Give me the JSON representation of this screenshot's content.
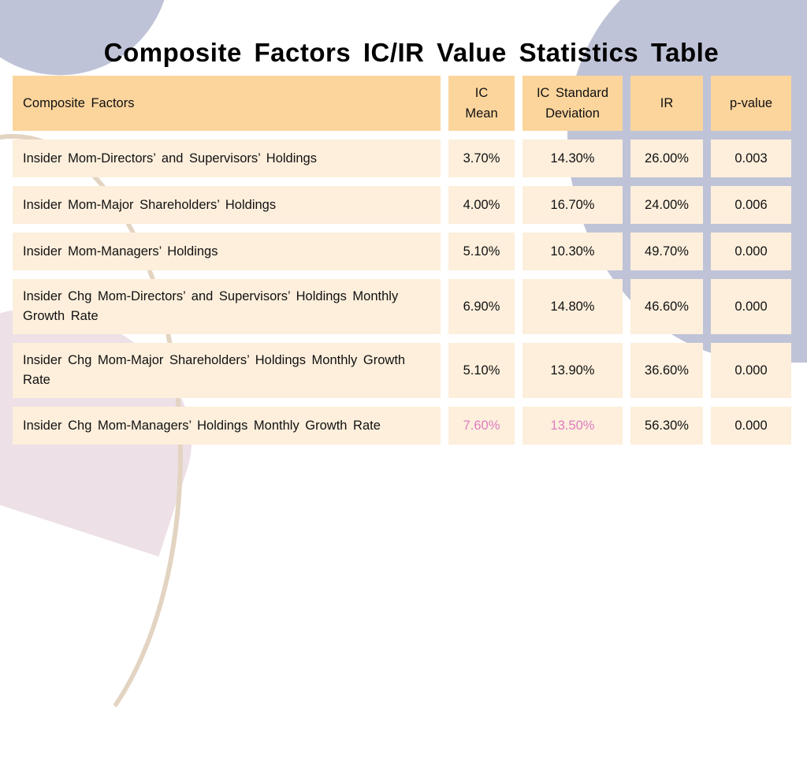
{
  "title": "Composite Factors IC/IR Value Statistics Table",
  "colors": {
    "header_bg": "#fcd59d",
    "cell_bg": "#fdefdc",
    "highlight_text": "#e07cc0",
    "accent_shape": "#bfc3d7"
  },
  "table": {
    "headers": [
      "Composite Factors",
      "IC\nMean",
      "IC Standard\nDeviation",
      "IR",
      "p-value"
    ],
    "rows": [
      {
        "factor": "Insider Mom-Directors’ and Supervisors’ Holdings",
        "ic_mean": "3.70%",
        "ic_std": "14.30%",
        "ir": "26.00%",
        "p_value": "0.003"
      },
      {
        "factor": "Insider Mom-Major Shareholders’ Holdings",
        "ic_mean": "4.00%",
        "ic_std": "16.70%",
        "ir": "24.00%",
        "p_value": "0.006"
      },
      {
        "factor": "Insider Mom-Managers’ Holdings",
        "ic_mean": "5.10%",
        "ic_std": "10.30%",
        "ir": "49.70%",
        "p_value": "0.000"
      },
      {
        "factor": "Insider Chg Mom-Directors’ and Supervisors’ Holdings Monthly Growth Rate",
        "ic_mean": "6.90%",
        "ic_std": "14.80%",
        "ir": "46.60%",
        "p_value": "0.000"
      },
      {
        "factor": "Insider Chg Mom-Major Shareholders’ Holdings Monthly Growth Rate",
        "ic_mean": "5.10%",
        "ic_std": "13.90%",
        "ir": "36.60%",
        "p_value": "0.000"
      },
      {
        "factor": "Insider Chg Mom-Managers’ Holdings Monthly Growth Rate",
        "ic_mean": "7.60%",
        "ic_std": "13.50%",
        "ir": "56.30%",
        "p_value": "0.000",
        "highlighted": [
          "ic_mean",
          "ic_std"
        ]
      }
    ]
  }
}
